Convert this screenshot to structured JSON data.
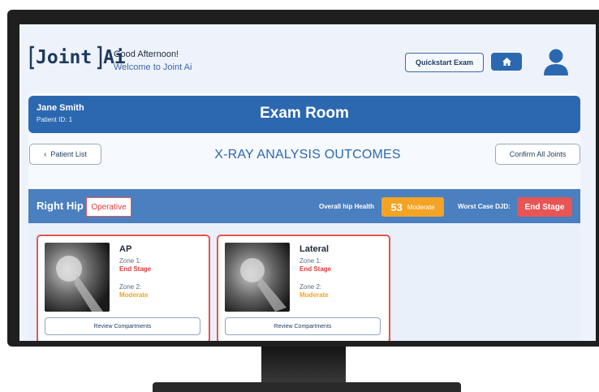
{
  "header": {
    "logo_text": "Joint Ai",
    "greeting": "Good Afternoon!",
    "welcome": "Welcome to Joint Ai",
    "quickstart_label": "Quickstart Exam"
  },
  "exam_bar": {
    "patient_name": "Jane Smith",
    "patient_id": "Patient ID: 1",
    "title": "Exam Room"
  },
  "toolbar": {
    "patient_list_label": "Patient List",
    "page_title": "X-RAY ANALYSIS OUTCOMES",
    "confirm_label": "Confirm All Joints"
  },
  "joint": {
    "name": "Right Hip",
    "status": "Operative",
    "overall_label": "Overall hip Health",
    "overall_score": "53",
    "overall_grade": "Moderate",
    "worst_label": "Worst Case DJD:",
    "worst_value": "End Stage"
  },
  "views": [
    {
      "name": "AP",
      "zone1_label": "Zone 1:",
      "zone1_value": "End Stage",
      "zone2_label": "Zone 2:",
      "zone2_value": "Moderate",
      "review_label": "Review Compartments"
    },
    {
      "name": "Lateral",
      "zone1_label": "Zone 1:",
      "zone1_value": "End Stage",
      "zone2_label": "Zone 2:",
      "zone2_value": "Moderate",
      "review_label": "Review Compartments"
    }
  ],
  "colors": {
    "primary": "#2c68b0",
    "moderate": "#f3a325",
    "end_stage": "#e85555"
  }
}
